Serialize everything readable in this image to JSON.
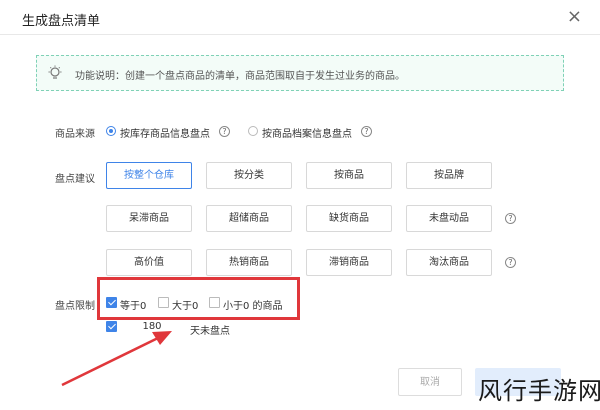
{
  "dialog": {
    "title": "生成盘点清单",
    "close_icon": "×"
  },
  "tip": {
    "icon": "lightbulb-icon",
    "text": "功能说明：创建一个盘点商品的清单，商品范围取自于发生过业务的商品。"
  },
  "source": {
    "label": "商品来源",
    "options": [
      {
        "label": "按库存商品信息盘点",
        "checked": true
      },
      {
        "label": "按商品档案信息盘点",
        "checked": false
      }
    ]
  },
  "suggest": {
    "label": "盘点建议",
    "row1": [
      "按整个仓库",
      "按分类",
      "按商品",
      "按品牌"
    ],
    "row2": [
      "呆滞商品",
      "超储商品",
      "缺货商品",
      "未盘动品"
    ],
    "row3": [
      "高价值",
      "热销商品",
      "滞销商品",
      "淘汰商品"
    ],
    "active": "按整个仓库"
  },
  "limit": {
    "label": "盘点限制",
    "options": [
      {
        "label": "等于0",
        "checked": true
      },
      {
        "label": "大于0",
        "checked": false
      },
      {
        "label": "小于0 的商品",
        "checked": false
      }
    ],
    "days_checked": true,
    "days_value": "180",
    "days_suffix": "天未盘点"
  },
  "footer": {
    "cancel": "取消"
  },
  "watermark": "风行手游网",
  "colors": {
    "accent": "#3f84e8",
    "highlight": "#e0373b",
    "tip_border": "#7fd1b6"
  }
}
